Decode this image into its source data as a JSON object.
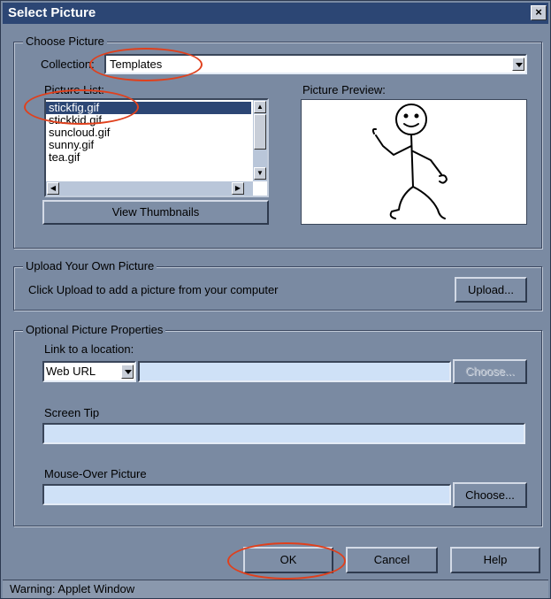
{
  "window": {
    "title": "Select Picture",
    "close_glyph": "×"
  },
  "choose_picture": {
    "legend": "Choose Picture",
    "collection_label": "Collection:",
    "collection_value": "Templates",
    "picture_list_label": "Picture List:",
    "picture_list": [
      "stickfig.gif",
      "stickkid.gif",
      "suncloud.gif",
      "sunny.gif",
      "tea.gif"
    ],
    "selected_index": 0,
    "preview_label": "Picture Preview:",
    "view_thumbnails": "View Thumbnails"
  },
  "upload": {
    "legend": "Upload Your Own Picture",
    "description": "Click Upload to add a picture from your computer",
    "button": "Upload..."
  },
  "optional": {
    "legend": "Optional Picture Properties",
    "link_label": "Link to a location:",
    "link_type": "Web URL",
    "link_value": "",
    "link_choose": "Choose...",
    "screen_tip_label": "Screen Tip",
    "screen_tip_value": "",
    "mouseover_label": "Mouse-Over Picture",
    "mouseover_value": "",
    "mouseover_choose": "Choose..."
  },
  "footer": {
    "ok": "OK",
    "cancel": "Cancel",
    "help": "Help"
  },
  "status": "Warning: Applet Window",
  "annotations": {
    "highlight_color": "#e0401c"
  }
}
